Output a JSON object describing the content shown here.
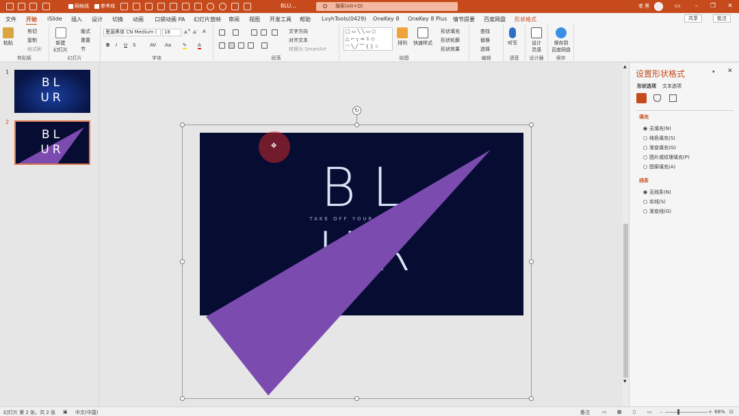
{
  "titlebar": {
    "checkbox_gridlines": "网格线",
    "checkbox_guides": "参考线",
    "doc_name": "BLU...",
    "search_placeholder": "搜索(Alt+Q)",
    "user": "老 黑"
  },
  "tabs": [
    "文件",
    "开始",
    "iSlide",
    "插入",
    "设计",
    "切换",
    "动画",
    "口袋动画 PA",
    "幻灯片放映",
    "审阅",
    "视图",
    "开发工具",
    "帮助",
    "LvyhTools(0429)",
    "OneKey 8",
    "OneKey 8 Plus",
    "情节提要",
    "百度网盘",
    "形状格式"
  ],
  "active_tab": "开始",
  "share_label": "共享",
  "comment_label": "批注",
  "ribbon": {
    "clipboard": {
      "label": "剪贴板",
      "paste": "粘贴",
      "cut": "剪切",
      "copy": "复制",
      "format_painter": "格式刷"
    },
    "slides": {
      "label": "幻灯片",
      "new_slide": "新建\n幻灯片",
      "layout": "版式",
      "reset": "重置",
      "section": "节"
    },
    "font": {
      "label": "字体",
      "font_name": "思源黑体 CN Medium (",
      "font_size": "18"
    },
    "paragraph": {
      "label": "段落",
      "text_direction": "文字方向",
      "align_text": "对齐文本",
      "convert_smartart": "转换为 SmartArt"
    },
    "drawing": {
      "label": "绘图",
      "arrange": "排列",
      "quick_styles": "快速样式",
      "shape_fill": "形状填充",
      "shape_outline": "形状轮廓",
      "shape_effects": "形状效果"
    },
    "editing": {
      "label": "编辑",
      "find": "查找",
      "replace": "替换",
      "select": "选择"
    },
    "voice": {
      "label": "语音",
      "dictate": "听写"
    },
    "designer": {
      "label": "设计器",
      "design_ideas": "设计\n灵感"
    },
    "save": {
      "label": "保存",
      "save_to_baidu": "保存到\n百度网盘"
    }
  },
  "slides": [
    {
      "number": "1",
      "line1": "BL",
      "line2": "UR"
    },
    {
      "number": "2",
      "line1": "BL",
      "line2": "UR"
    }
  ],
  "slide": {
    "word1": "BL",
    "word2": "UR",
    "tagline": "TAKE OFF YOUR GLASSES"
  },
  "colors": {
    "accent": "#c64a1b",
    "slide_bg": "#070c33",
    "shape_purple": "#7b4bb0",
    "text_light": "#d7e6f7"
  },
  "pane": {
    "title": "设置形状格式",
    "tab_shape": "形状选项",
    "tab_text": "文本选项",
    "fill_section": "填充",
    "fill_options": [
      "无填充(N)",
      "纯色填充(S)",
      "渐变填充(G)",
      "图片或纹理填充(P)",
      "图案填充(A)"
    ],
    "fill_selected": 0,
    "line_section": "线条",
    "line_options": [
      "无线条(N)",
      "实线(S)",
      "渐变线(G)"
    ],
    "line_selected": 0
  },
  "status": {
    "slide_info": "幻灯片 第 2 张，共 2 张",
    "language": "中文(中国)",
    "notes": "备注",
    "zoom": "66%"
  }
}
